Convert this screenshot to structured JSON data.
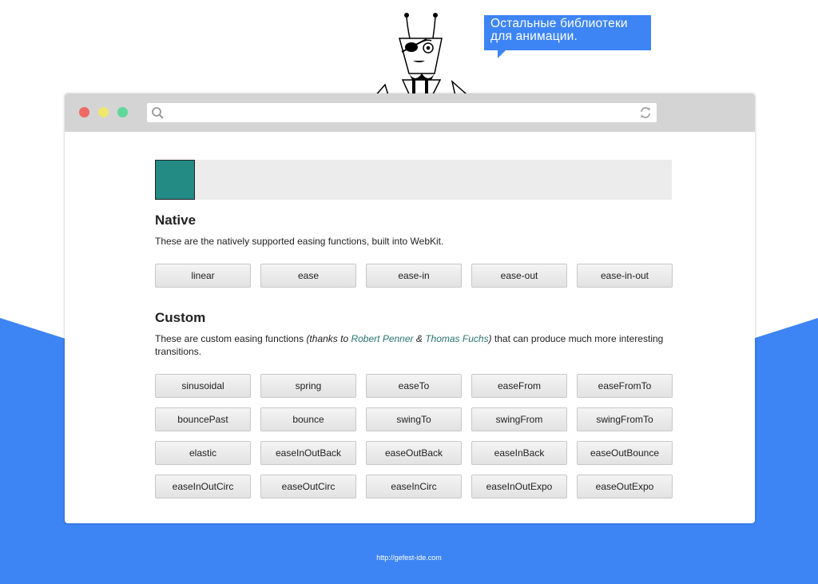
{
  "bubble": {
    "line1": "Остальные библиотеки",
    "line2": "для анимации."
  },
  "colors": {
    "accent": "#3d84f5",
    "box": "#238a84",
    "link": "#26756f"
  },
  "native": {
    "title": "Native",
    "desc": "These are the natively supported easing functions, built into WebKit.",
    "buttons": [
      "linear",
      "ease",
      "ease-in",
      "ease-out",
      "ease-in-out"
    ]
  },
  "custom": {
    "title": "Custom",
    "desc_pre": "These are custom easing functions ",
    "thanks": "(thanks to ",
    "author1": "Robert Penner",
    "amp": " & ",
    "author2": "Thomas Fuchs",
    "close": ")",
    "desc_post": " that can produce much more interesting transitions.",
    "buttons": [
      "sinusoidal",
      "spring",
      "easeTo",
      "easeFrom",
      "easeFromTo",
      "bouncePast",
      "bounce",
      "swingTo",
      "swingFrom",
      "swingFromTo",
      "elastic",
      "easeInOutBack",
      "easeOutBack",
      "easeInBack",
      "easeOutBounce",
      "easeInOutCirc",
      "easeOutCirc",
      "easeInCirc",
      "easeInOutExpo",
      "easeOutExpo"
    ]
  },
  "footer": "http://gefest-ide.com"
}
